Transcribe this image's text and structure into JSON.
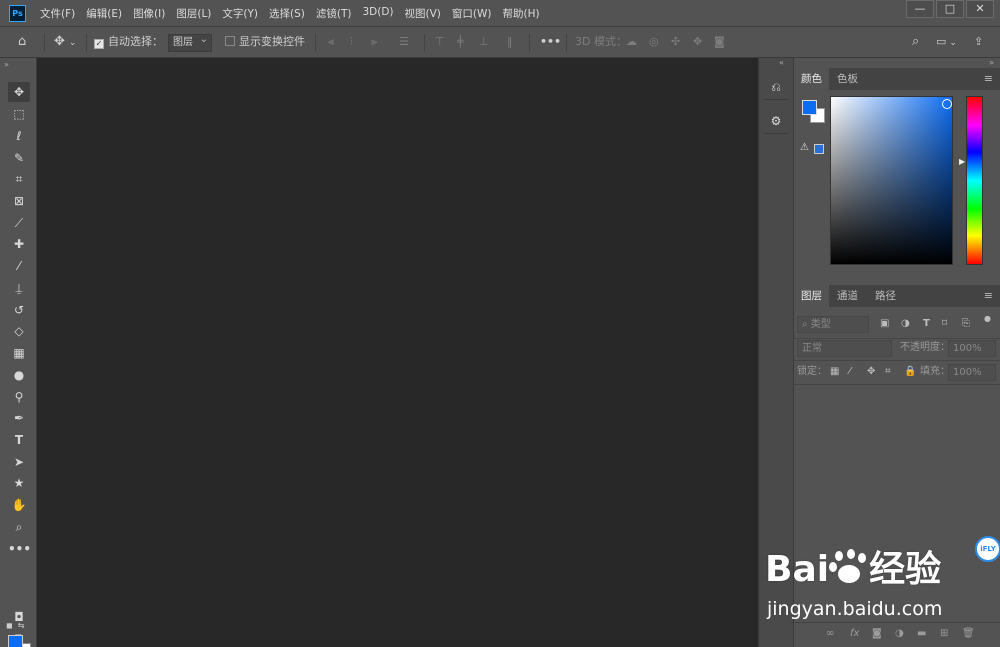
{
  "app": {
    "logo": "Ps"
  },
  "menu": [
    "文件(F)",
    "编辑(E)",
    "图像(I)",
    "图层(L)",
    "文字(Y)",
    "选择(S)",
    "滤镜(T)",
    "3D(D)",
    "视图(V)",
    "窗口(W)",
    "帮助(H)"
  ],
  "window": {
    "minimize": "—",
    "maximize": "□",
    "close": "✕"
  },
  "options": {
    "auto_select_label": "自动选择：",
    "auto_select_value": "图层",
    "show_transform_label": "显示变换控件",
    "more": "•••",
    "mode_3d_label": "3D 模式："
  },
  "toolbar": {
    "tools": [
      "move",
      "marquee",
      "lasso",
      "quick-select",
      "crop",
      "frame",
      "eyedropper",
      "healing",
      "brush",
      "stamp",
      "history-brush",
      "eraser",
      "gradient",
      "blur",
      "dodge",
      "pen",
      "type",
      "path-select",
      "shape",
      "hand",
      "zoom",
      "more"
    ],
    "foreground_color": "#0d6df2",
    "background_color": "#ffffff"
  },
  "color_panel": {
    "tabs": [
      "颜色",
      "色板"
    ],
    "active_tab": "颜色",
    "foreground": "#0d6df2",
    "background": "#ffffff"
  },
  "layers_panel": {
    "tabs": [
      "图层",
      "通道",
      "路径"
    ],
    "active_tab": "图层",
    "filter_placeholder": "类型",
    "blend_mode": "正常",
    "opacity_label": "不透明度：",
    "opacity_value": "100%",
    "lock_label": "锁定：",
    "fill_label": "填充：",
    "fill_value": "100%"
  },
  "watermark": {
    "brand": "Bai  经验",
    "url": "jingyan.baidu.com",
    "badge": "iFLY"
  }
}
